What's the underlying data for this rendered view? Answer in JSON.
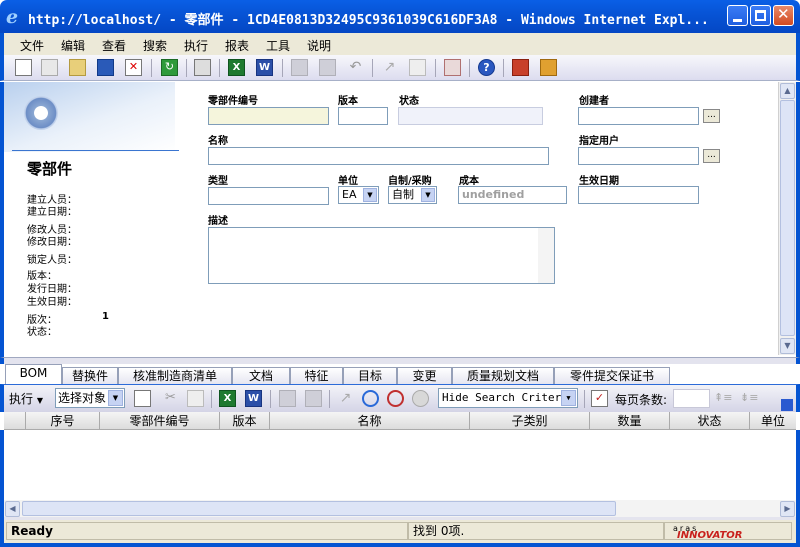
{
  "window": {
    "title": "http://localhost/ - 零部件 - 1CD4E0813D32495C9361039C616DF3A8 - Windows Internet Expl..."
  },
  "menu": [
    "文件",
    "编辑",
    "查看",
    "搜索",
    "执行",
    "报表",
    "工具",
    "说明"
  ],
  "item_type": "零部件",
  "side_labels": {
    "created_by": "建立人员：",
    "created_on": "建立日期：",
    "modified_by": "修改人员：",
    "modified_on": "修改日期：",
    "locked_by": "锁定人员：",
    "version": "版本：",
    "release_date": "发行日期：",
    "effective_date": "生效日期：",
    "generation": "版次：",
    "generation_value": "1",
    "state": "状态："
  },
  "form": {
    "item_number_label": "零部件编号",
    "revision_label": "版本",
    "state_label": "状态",
    "creator_label": "创建者",
    "name_label": "名称",
    "assigned_user_label": "指定用户",
    "type_label": "类型",
    "unit_label": "单位",
    "unit_value": "EA",
    "make_buy_label": "自制/采购",
    "make_buy_value": "自制",
    "cost_label": "成本",
    "cost_value": "undefined",
    "effective_date_label": "生效日期",
    "description_label": "描述",
    "ellipsis": "..."
  },
  "tabs": [
    "BOM",
    "替换件",
    "核准制造商清单",
    "文档",
    "特征",
    "目标",
    "变更",
    "质量规划文档",
    "零件提交保证书"
  ],
  "bom_toolbar": {
    "action_label": "执行",
    "select_object": "选择对象",
    "search_mode": "Hide Search Criteria",
    "page_size_label": "每页条数:"
  },
  "grid_columns": [
    "序号",
    "零部件编号",
    "版本",
    "名称",
    "子类别",
    "数量",
    "状态",
    "单位"
  ],
  "status": {
    "ready": "Ready",
    "found": "找到 0项.",
    "brand_top": "aras",
    "brand": "INNOVATOR"
  },
  "colors": {
    "accent_blue": "#0454d2",
    "required_field": "#f5f5dc",
    "brand_red": "#c8201c"
  }
}
